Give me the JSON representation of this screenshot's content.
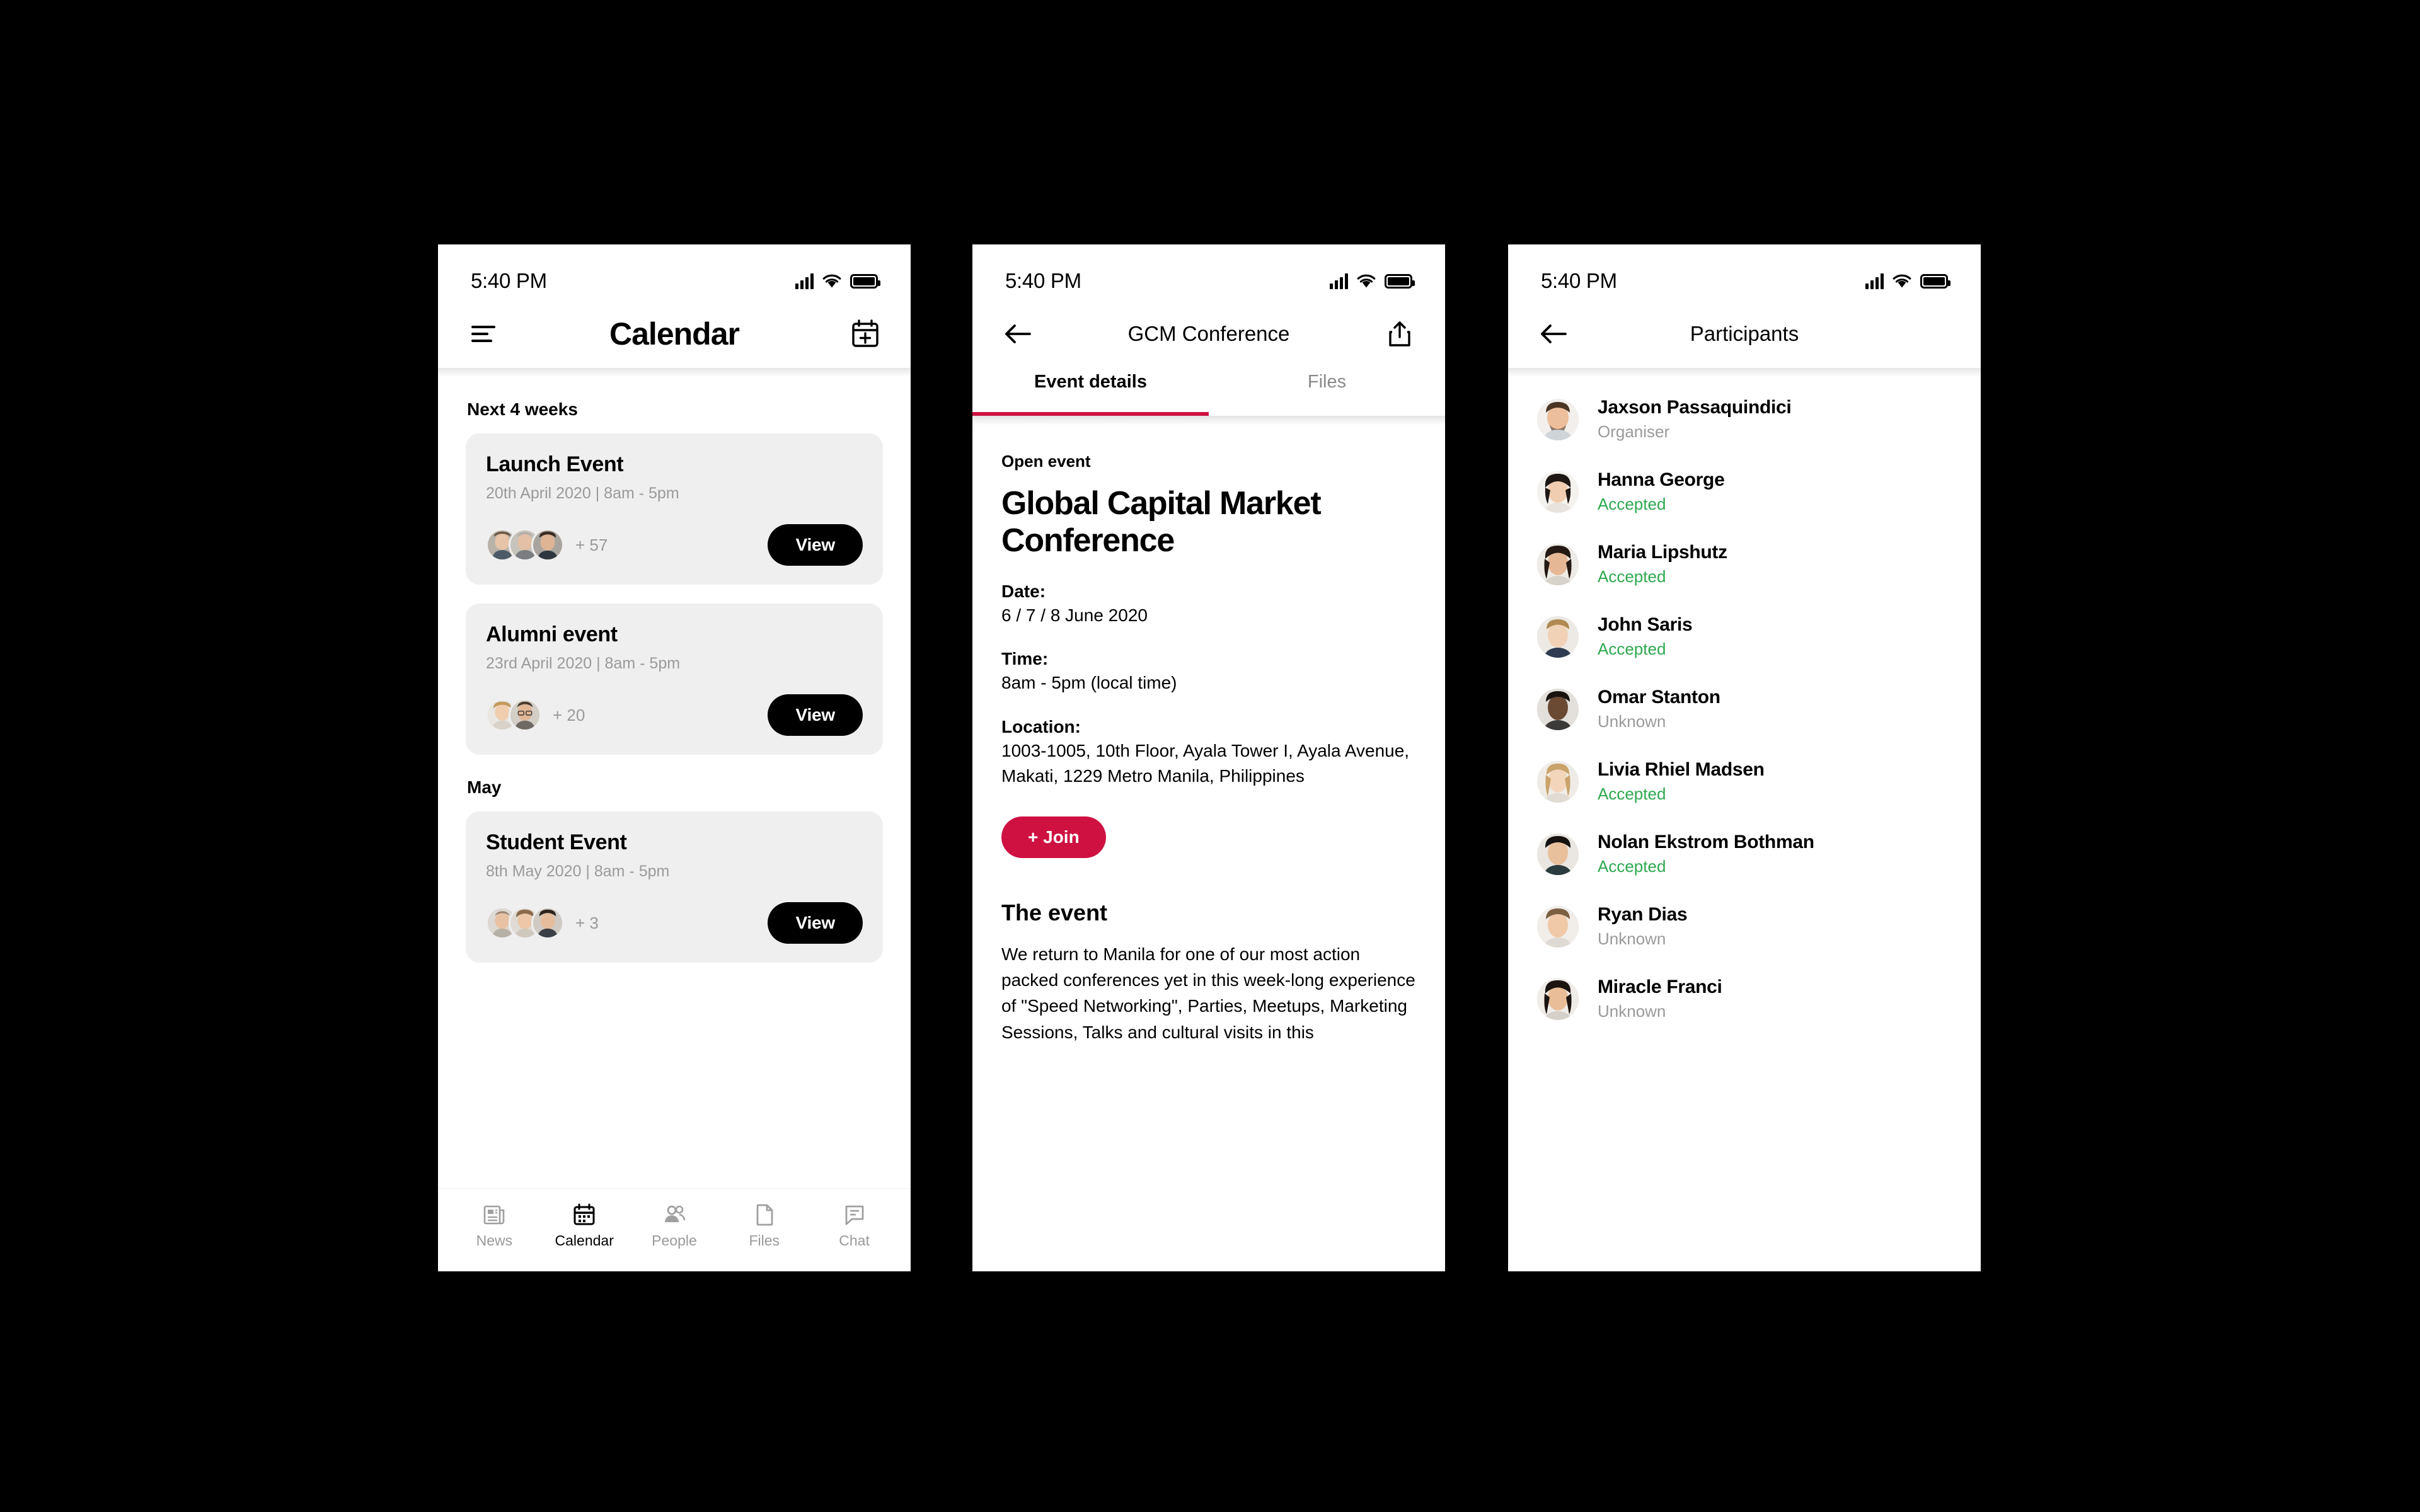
{
  "colors": {
    "accent_red": "#ce1141",
    "accepted_green": "#2ea84f",
    "muted_grey": "#9a9a9a",
    "card_grey": "#efefef",
    "black": "#000000"
  },
  "status_bar": {
    "time": "5:40 PM",
    "signal_icon": "cellular-signal-icon",
    "wifi_icon": "wifi-icon",
    "battery_icon": "battery-full-icon"
  },
  "screen_calendar": {
    "nav": {
      "menu_icon": "hamburger-menu-icon",
      "title": "Calendar",
      "add_icon": "add-calendar-event-icon"
    },
    "sections": [
      {
        "label": "Next 4 weeks",
        "events": [
          {
            "title": "Launch Event",
            "meta": "20th April 2020 | 8am - 5pm",
            "avatar_count": "+ 57",
            "avatars": 3,
            "view_label": "View"
          },
          {
            "title": "Alumni event",
            "meta": "23rd April 2020 | 8am - 5pm",
            "avatar_count": "+ 20",
            "avatars": 2,
            "view_label": "View"
          }
        ]
      },
      {
        "label": "May",
        "events": [
          {
            "title": "Student Event",
            "meta": "8th May 2020 | 8am - 5pm",
            "avatar_count": "+ 3",
            "avatars": 3,
            "view_label": "View"
          }
        ]
      }
    ],
    "tabbar": [
      {
        "label": "News",
        "icon": "news-icon",
        "active": false
      },
      {
        "label": "Calendar",
        "icon": "calendar-icon",
        "active": true
      },
      {
        "label": "People",
        "icon": "people-icon",
        "active": false
      },
      {
        "label": "Files",
        "icon": "file-icon",
        "active": false
      },
      {
        "label": "Chat",
        "icon": "chat-icon",
        "active": false
      }
    ]
  },
  "screen_event": {
    "nav": {
      "back_icon": "back-arrow-icon",
      "title": "GCM Conference",
      "share_icon": "share-icon"
    },
    "tabs": [
      {
        "label": "Event details",
        "active": true
      },
      {
        "label": "Files",
        "active": false
      }
    ],
    "kicker": "Open event",
    "headline": "Global Capital Market Conference",
    "fields": [
      {
        "label": "Date:",
        "value": "6 / 7 / 8 June 2020"
      },
      {
        "label": "Time:",
        "value": "8am - 5pm (local time)"
      },
      {
        "label": "Location:",
        "value": "1003-1005, 10th Floor, Ayala Tower I, Ayala Avenue, Makati, 1229 Metro Manila, Philippines"
      }
    ],
    "join_label": "+ Join",
    "section_heading": "The event",
    "section_text": "We return to Manila for one of our most action packed conferences yet in this week-long experience of \"Speed Networking\", Parties, Meetups, Marketing Sessions, Talks and cultural visits in this"
  },
  "screen_participants": {
    "nav": {
      "back_icon": "back-arrow-icon",
      "title": "Participants"
    },
    "participants": [
      {
        "name": "Jaxson Passaquindici",
        "status": "Organiser",
        "status_type": "organiser"
      },
      {
        "name": "Hanna George",
        "status": "Accepted",
        "status_type": "accepted"
      },
      {
        "name": "Maria Lipshutz",
        "status": "Accepted",
        "status_type": "accepted"
      },
      {
        "name": "John Saris",
        "status": "Accepted",
        "status_type": "accepted"
      },
      {
        "name": "Omar Stanton",
        "status": "Unknown",
        "status_type": "unknown"
      },
      {
        "name": "Livia Rhiel Madsen",
        "status": "Accepted",
        "status_type": "accepted"
      },
      {
        "name": "Nolan Ekstrom Bothman",
        "status": "Accepted",
        "status_type": "accepted"
      },
      {
        "name": "Ryan Dias",
        "status": "Unknown",
        "status_type": "unknown"
      },
      {
        "name": "Miracle Franci",
        "status": "Unknown",
        "status_type": "unknown"
      }
    ]
  }
}
